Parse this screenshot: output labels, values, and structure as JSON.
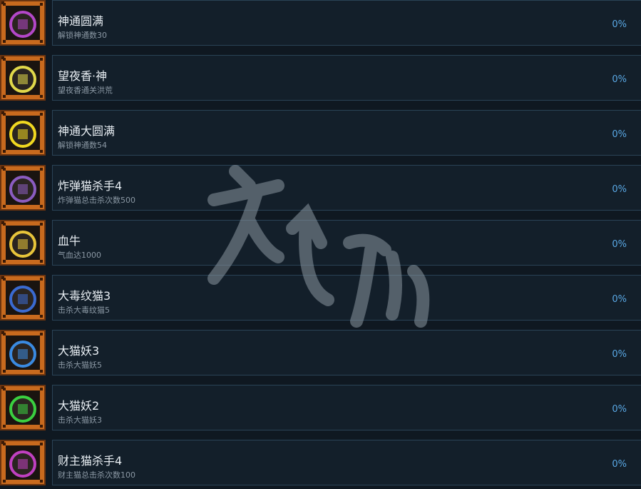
{
  "achievements": [
    {
      "title": "神通圆满",
      "desc": "解锁神通数30",
      "pct": "0%",
      "icon": "purple-lattice-icon",
      "color": "#b347c8"
    },
    {
      "title": "望夜香·神",
      "desc": "望夜香通关洪荒",
      "pct": "0%",
      "icon": "wolf-face-icon",
      "color": "#e0d84a"
    },
    {
      "title": "神通大圆满",
      "desc": "解锁神通数54",
      "pct": "0%",
      "icon": "gold-lattice-icon",
      "color": "#f0d820"
    },
    {
      "title": "炸弹猫杀手4",
      "desc": "炸弹猫总击杀次数500",
      "pct": "0%",
      "icon": "bomb-cat-icon",
      "color": "#8a5cc0"
    },
    {
      "title": "血牛",
      "desc": "气血达1000",
      "pct": "0%",
      "icon": "meditating-monk-icon",
      "color": "#e8c43a"
    },
    {
      "title": "大毒纹猫3",
      "desc": "击杀大毒纹猫5",
      "pct": "0%",
      "icon": "poison-cat-icon",
      "color": "#3a6ad0"
    },
    {
      "title": "大猫妖3",
      "desc": "击杀大猫妖5",
      "pct": "0%",
      "icon": "cat-demon-blue-icon",
      "color": "#3a8ae0"
    },
    {
      "title": "大猫妖2",
      "desc": "击杀大猫妖3",
      "pct": "0%",
      "icon": "cat-demon-green-icon",
      "color": "#3ad040"
    },
    {
      "title": "财主猫杀手4",
      "desc": "财主猫总击杀次数100",
      "pct": "0%",
      "icon": "rich-cat-icon",
      "color": "#c040c0"
    }
  ]
}
